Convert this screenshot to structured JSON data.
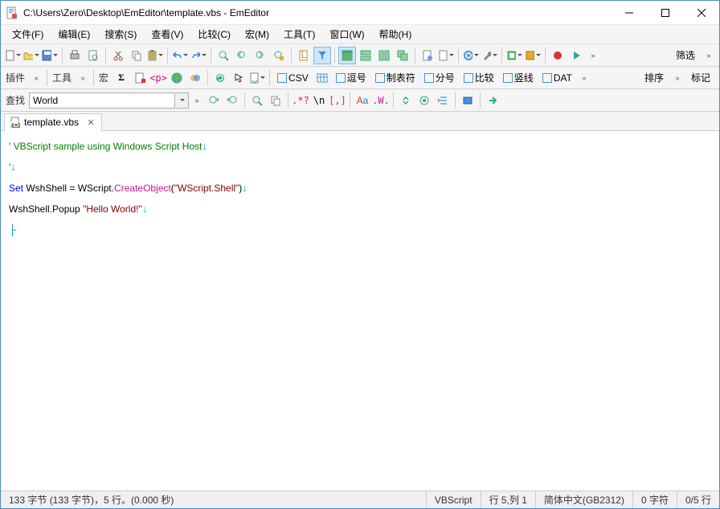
{
  "window": {
    "title": "C:\\Users\\Zero\\Desktop\\EmEditor\\template.vbs - EmEditor"
  },
  "menu": {
    "file": "文件(F)",
    "edit": "编辑(E)",
    "search": "搜索(S)",
    "view": "查看(V)",
    "compare": "比较(C)",
    "macro": "宏(M)",
    "tools": "工具(T)",
    "window": "窗口(W)",
    "help": "帮助(H)"
  },
  "toolbar1_right": {
    "filter": "筛选"
  },
  "toolbar2": {
    "plugin": "插件",
    "tools": "工具",
    "macro": "宏",
    "sigma": "Σ",
    "csv": "CSV",
    "comma": "逗号",
    "tab": "制表符",
    "semi": "分号",
    "compare": "比较",
    "vline": "竖线",
    "dat": "DAT",
    "sort": "排序",
    "mark": "标记"
  },
  "findbar": {
    "label": "查找",
    "value": "World",
    "regex": ".*?",
    "nl": "\\n",
    "brackets": "[,]",
    "aa": "Aa",
    "w": ".W."
  },
  "tab": {
    "name": "template.vbs"
  },
  "code": {
    "l1_comment": "' VBScript sample using Windows Script Host",
    "l2": "'",
    "l3_set": "Set",
    "l3_a": " WshShell = WScript.",
    "l3_m": "CreateObject",
    "l3_p1": "(",
    "l3_s": "\"WScript.Shell\"",
    "l3_p2": ")",
    "l4_a": "WshShell.Popup ",
    "l4_s": "\"Hello World!\"",
    "eol": "↓"
  },
  "status": {
    "bytes": "133 字节 (133 字节)，5 行。(0.000 秒)",
    "lang": "VBScript",
    "pos": "行 5,列 1",
    "enc": "简体中文(GB2312)",
    "chars": "0 字符",
    "lines": "0/5 行"
  }
}
